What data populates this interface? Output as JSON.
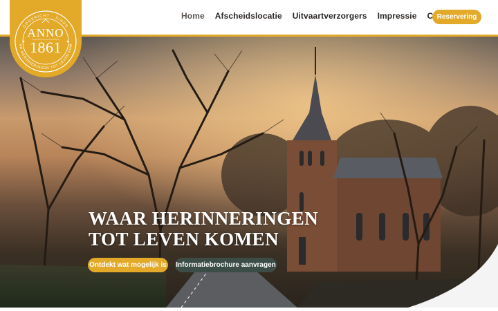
{
  "logo": {
    "line1": "ANNO",
    "line2": "1861",
    "ring_top": "OPGERICHT · SINDS",
    "ring_bottom": "WAAR HERINNERINGEN TOT LEVEN KOMEN"
  },
  "nav": {
    "items": [
      {
        "label": "Home",
        "active": true
      },
      {
        "label": "Afscheidslocatie"
      },
      {
        "label": "Uitvaartverzorgers"
      },
      {
        "label": "Impressie"
      },
      {
        "label": "Contact"
      }
    ],
    "reservation_label": "Reservering"
  },
  "hero": {
    "title_line1": "WAAR HERINNERINGEN",
    "title_line2": "TOT LEVEN KOMEN",
    "cta_primary": "Ontdekt wat mogelijk is",
    "cta_secondary": "Informatiebrochure aanvragen"
  },
  "colors": {
    "accent": "#e3a928",
    "secondary": "#3b4d46",
    "text": "#2a2623"
  }
}
